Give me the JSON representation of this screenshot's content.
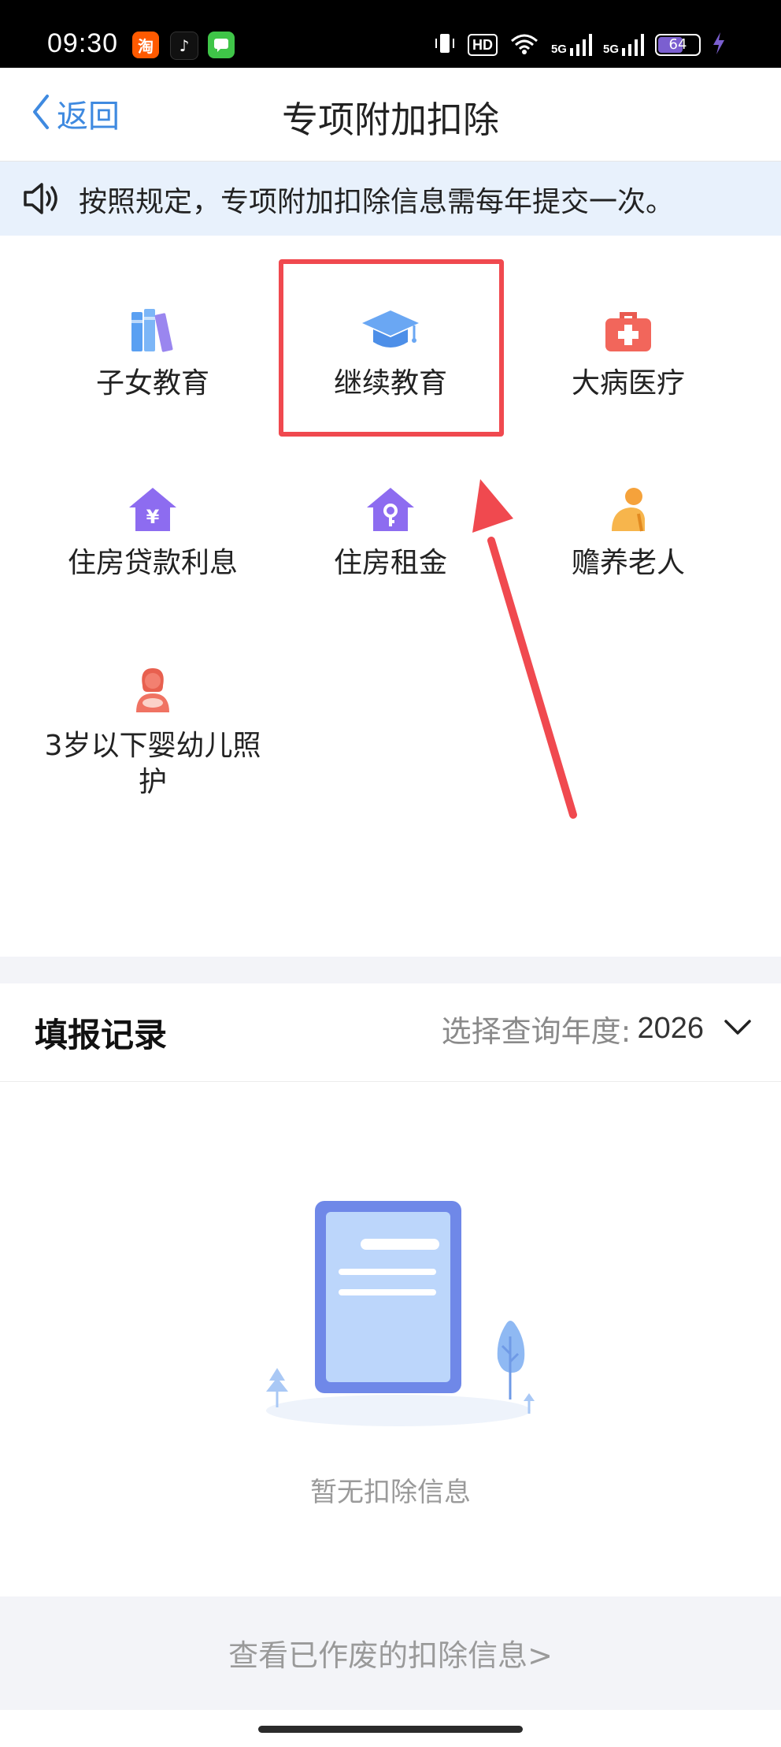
{
  "status_bar": {
    "time": "09:30",
    "apps": [
      {
        "name": "taobao-icon",
        "glyph": "淘",
        "color": "#ff5a00"
      },
      {
        "name": "tiktok-icon",
        "glyph": "♪",
        "color": "#111111"
      },
      {
        "name": "messages-icon",
        "glyph": "▭",
        "color": "#3fc548"
      }
    ],
    "hd_label": "HD",
    "signal_1": "5G",
    "signal_2": "5G",
    "battery": "64",
    "battery_level": 0.64
  },
  "nav": {
    "back_label": "返回",
    "title": "专项附加扣除"
  },
  "notice": {
    "text": "按照规定，专项附加扣除信息需每年提交一次。"
  },
  "categories": [
    {
      "label": "子女教育",
      "icon": "books-icon"
    },
    {
      "label": "继续教育",
      "icon": "graduation-cap-icon"
    },
    {
      "label": "大病医疗",
      "icon": "first-aid-kit-icon"
    },
    {
      "label": "住房贷款利息",
      "icon": "house-yuan-icon"
    },
    {
      "label": "住房租金",
      "icon": "house-key-icon"
    },
    {
      "label": "赡养老人",
      "icon": "elderly-person-icon"
    },
    {
      "label": "3岁以下婴幼儿照",
      "label2": "护",
      "icon": "mother-baby-icon"
    }
  ],
  "records": {
    "title": "填报记录",
    "year_label": "选择查询年度:",
    "year_value": "2026",
    "empty_text": "暂无扣除信息",
    "void_link": "查看已作废的扣除信息>"
  },
  "colors": {
    "accent": "#3f8ae0",
    "highlight": "#f0494f",
    "banner": "#e8f1fc"
  }
}
